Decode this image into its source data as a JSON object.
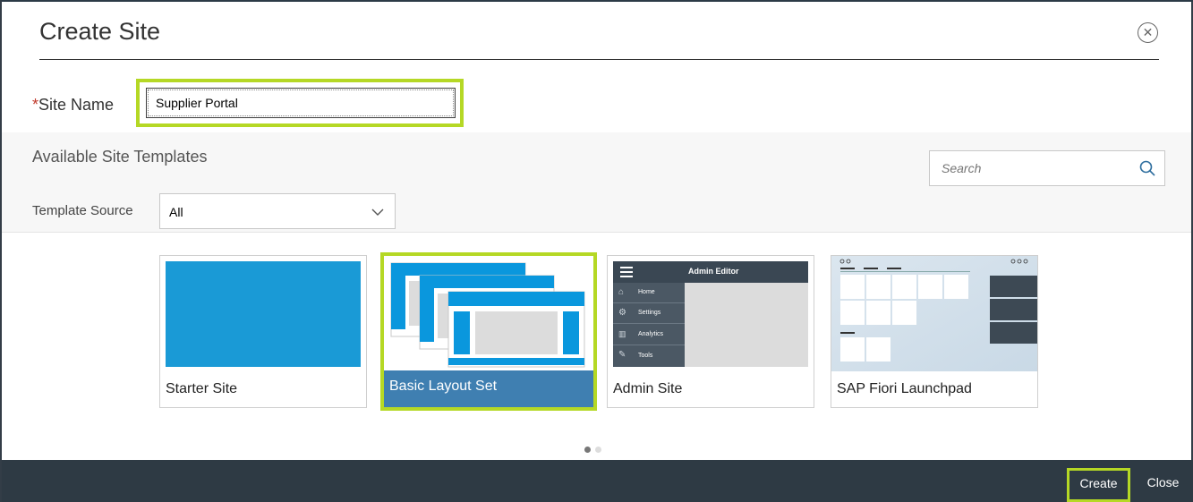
{
  "dialog": {
    "title": "Create Site",
    "close_icon": "close-circle-icon"
  },
  "site_name": {
    "required_mark": "*",
    "label": "Site Name",
    "value": "Supplier Portal"
  },
  "templates": {
    "title": "Available Site Templates",
    "search_placeholder": "Search",
    "search_icon": "search-icon",
    "source_label": "Template Source",
    "source_value": "All",
    "source_icon": "chevron-down-icon",
    "items": [
      {
        "label": "Starter Site",
        "selected": false
      },
      {
        "label": "Basic Layout Set",
        "selected": true
      },
      {
        "label": "Admin Site",
        "selected": false
      },
      {
        "label": "SAP Fiori Launchpad",
        "selected": false
      }
    ],
    "admin_preview": {
      "header": "Admin Editor",
      "menu": [
        "Home",
        "Settings",
        "Analytics",
        "Tools"
      ]
    },
    "pager": {
      "pages": 2,
      "current": 1
    }
  },
  "footer": {
    "create_label": "Create",
    "close_label": "Close"
  },
  "colors": {
    "accent_highlight": "#b5d825",
    "selected_tile": "#3f7fb1",
    "template_blue": "#1a9ad6",
    "footer_bg": "#2e3a44"
  }
}
